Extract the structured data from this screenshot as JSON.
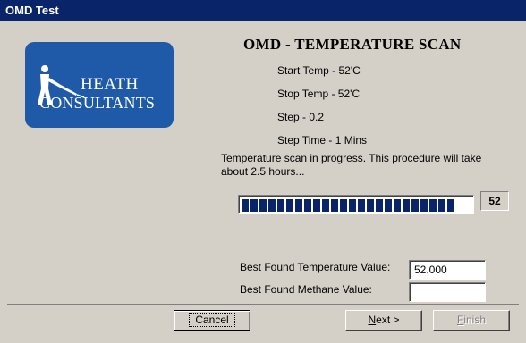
{
  "window": {
    "title": "OMD Test"
  },
  "logo": {
    "line1": "HEATH",
    "line2": "CONSULTANTS",
    "color": "#1e5aa8"
  },
  "scan": {
    "heading": "OMD - TEMPERATURE SCAN",
    "start_temp": "Start Temp - 52'C",
    "stop_temp": "Stop Temp - 52'C",
    "step": "Step - 0.2",
    "step_time": "Step Time - 1 Mins",
    "status_message": "Temperature scan in progress. This procedure will take about 2.5 hours...",
    "progress_fraction": 0.95,
    "progress_value": "52"
  },
  "results": {
    "best_temp_label": "Best Found Temperature Value:",
    "best_temp_value": "52.000",
    "best_methane_label": "Best Found Methane Value:",
    "best_methane_value": ""
  },
  "buttons": {
    "cancel": "Cancel",
    "next_underlined": "N",
    "next_rest": "ext >",
    "finish_underlined": "F",
    "finish_rest": "inish"
  },
  "colors": {
    "titlebar": "#0a246a",
    "progress": "#0a246a",
    "face": "#d4d0c8"
  }
}
